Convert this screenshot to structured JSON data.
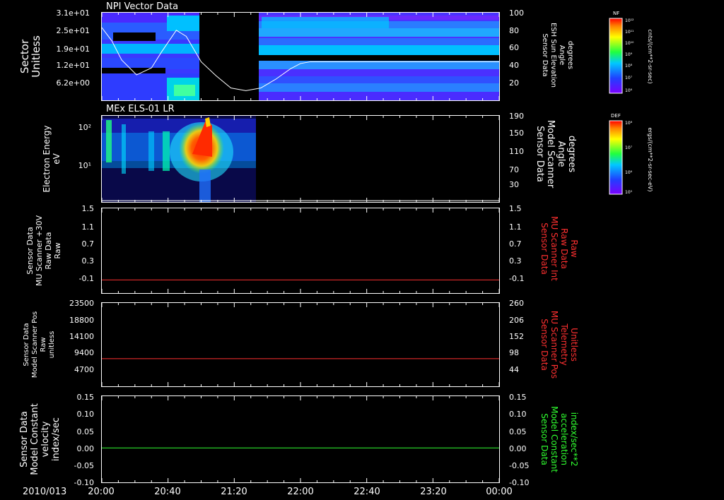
{
  "chart_data": [
    {
      "type": "heatmap",
      "title": "NPI Vector Data",
      "ylabel": [
        "Sector",
        "Unitless"
      ],
      "yticks": [
        "3.1e+01",
        "2.5e+01",
        "1.9e+01",
        "1.2e+01",
        "6.2e+00"
      ],
      "right_ylabel": [
        "Sensor Data",
        "ESH Sun Elevation",
        "Angle",
        "degrees"
      ],
      "right_yticks": [
        "100",
        "80",
        "60",
        "40",
        "20"
      ],
      "right_ylim": [
        0,
        100
      ],
      "line_series": {
        "name": "ESH Sun Elevation Angle",
        "color": "#ffffff",
        "x_hours": [
          0,
          0.1,
          0.2,
          0.35,
          0.5,
          0.6,
          0.75,
          0.85,
          1.0,
          1.15,
          1.3,
          1.45,
          1.6,
          1.75,
          1.9,
          2.0,
          2.1,
          2.3,
          2.5,
          4.0
        ],
        "values": [
          83,
          68,
          46,
          29,
          37,
          55,
          80,
          73,
          44,
          28,
          14,
          11,
          14,
          24,
          36,
          42,
          44,
          44,
          44,
          44
        ]
      },
      "colorbar": {
        "label": "NF",
        "units": "cnts/(cm**2-sr-sec)",
        "ticks": [
          "10¹²",
          "10¹¹",
          "10¹⁰",
          "10⁹",
          "10⁸",
          "10⁷",
          "10⁶"
        ]
      }
    },
    {
      "type": "heatmap",
      "title": "MEx ELS-01 LR",
      "ylabel": [
        "Electron Energy",
        "eV"
      ],
      "yticks": [
        "10²",
        "10¹"
      ],
      "right_ylabel": [
        "Sensor Data",
        "Model Scanner",
        "Angle",
        "degrees"
      ],
      "right_yticks": [
        "190",
        "150",
        "110",
        "70",
        "30"
      ],
      "right_ylim": [
        0,
        190
      ],
      "line_series": {
        "name": "Model Scanner Angle",
        "color": "#ffffff",
        "x_hours": [
          0,
          4
        ],
        "values": [
          3,
          3
        ]
      },
      "colorbar": {
        "label": "DEF",
        "units": "ergs/(cm**2-sr-sec-eV)",
        "ticks": [
          "10⁸",
          "10⁷",
          "10⁶",
          "10⁵"
        ]
      }
    },
    {
      "type": "line",
      "ylabel": [
        "Sensor Data",
        "MU Scanner +30V",
        "Raw Data",
        "Raw"
      ],
      "yticks": [
        "1.5",
        "1.1",
        "0.7",
        "0.3",
        "-0.1"
      ],
      "ylim": [
        -0.3,
        1.5
      ],
      "right_ylabel": [
        "Sensor Data",
        "MU Scanner Int",
        "Raw Data",
        "Raw"
      ],
      "right_yticks": [
        "1.5",
        "1.1",
        "0.7",
        "0.3",
        "-0.1"
      ],
      "series": [
        {
          "color": "#ff3030",
          "x_hours": [
            0,
            4
          ],
          "values": [
            -0.02,
            -0.02
          ]
        }
      ]
    },
    {
      "type": "line",
      "ylabel": [
        "Sensor Data",
        "Model Scanner Pos",
        "Raw",
        "unitless"
      ],
      "yticks": [
        "23500",
        "18800",
        "14100",
        "9400",
        "4700"
      ],
      "ylim": [
        0,
        23500
      ],
      "right_ylabel": [
        "Sensor Data",
        "MU Scanner Pos",
        "Telemetry",
        "Unitless"
      ],
      "right_yticks": [
        "260",
        "206",
        "152",
        "98",
        "44"
      ],
      "series": [
        {
          "color": "#ff3030",
          "x_hours": [
            0,
            4
          ],
          "values": [
            7800,
            7800
          ]
        }
      ]
    },
    {
      "type": "line",
      "ylabel": [
        "Sensor Data",
        "Model Constant",
        "velocity",
        "index/sec"
      ],
      "yticks": [
        "0.15",
        "0.10",
        "0.05",
        "0.00",
        "-0.05",
        "-0.10"
      ],
      "ylim": [
        -0.1,
        0.15
      ],
      "right_ylabel": [
        "Sensor Data",
        "Model Constant",
        "acceleration",
        "index/sec**2"
      ],
      "right_yticks": [
        "0.15",
        "0.10",
        "0.05",
        "0.00",
        "-0.05",
        "-0.10"
      ],
      "series": [
        {
          "color": "#30ff30",
          "x_hours": [
            0,
            4
          ],
          "values": [
            0,
            0
          ]
        }
      ]
    }
  ],
  "time_axis": {
    "date": "2010/013",
    "ticks": [
      "20:00",
      "20:40",
      "21:20",
      "22:00",
      "22:40",
      "23:20",
      "00:00"
    ],
    "range_hours": [
      0,
      4
    ]
  }
}
